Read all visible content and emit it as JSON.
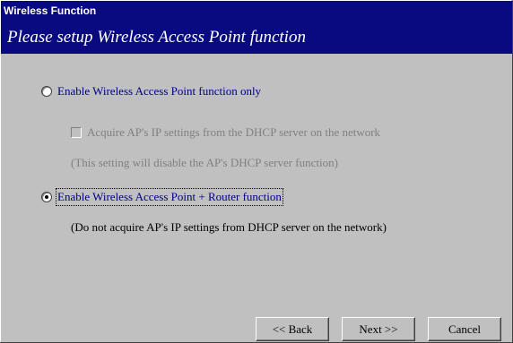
{
  "window": {
    "title": "Wireless Function",
    "heading": "Please setup Wireless Access Point function"
  },
  "options": {
    "ap_only": {
      "label": "Enable Wireless Access Point function only",
      "selected": false
    },
    "acquire_dhcp": {
      "label": "Acquire AP's IP settings from the DHCP server on the network",
      "checked": false,
      "enabled": false,
      "note": "(This setting will disable the AP's DHCP server function)"
    },
    "ap_router": {
      "label": "Enable Wireless Access Point + Router function",
      "selected": true,
      "note": "(Do not acquire AP's IP settings from DHCP server on the network)"
    }
  },
  "buttons": {
    "back": "<< Back",
    "next": "Next >>",
    "cancel": "Cancel"
  },
  "colors": {
    "title_bar": "#0a0a80",
    "dialog_bg": "#c0c0c0",
    "label_text": "#000080",
    "disabled_text": "#808080"
  }
}
